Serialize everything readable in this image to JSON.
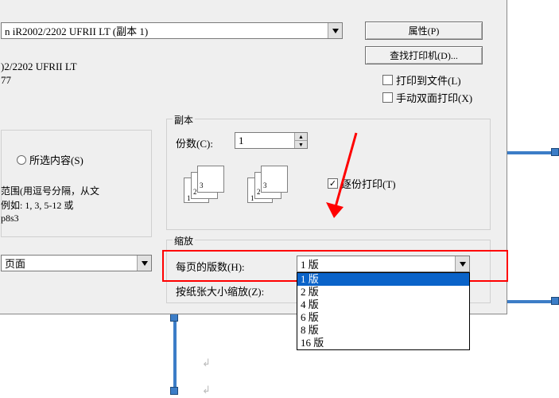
{
  "printer": {
    "selected": "n iR2002/2202 UFRII LT (副本 1)",
    "line2": ")2/2202 UFRII LT",
    "line3": "77"
  },
  "buttons": {
    "properties": "属性(P)",
    "findprinter": "查找打印机(D)..."
  },
  "checkboxes": {
    "printtofile": "打印到文件(L)",
    "manualduplex": "手动双面打印(X)",
    "collate": "逐份打印(T)"
  },
  "range": {
    "radio_selection": "所选内容(S)",
    "hint1": "范围(用逗号分隔，从文",
    "hint2": "例如: 1, 3, 5-12 或",
    "hint3": "p8s3"
  },
  "page_combo": "页面",
  "copies": {
    "legend": "副本",
    "label": "份数(C):",
    "value": "1",
    "small1": "1",
    "small2": "2",
    "small3": "3"
  },
  "scale": {
    "legend": "缩放",
    "pagesper_label": "每页的版数(H):",
    "pagesper_value": "1 版",
    "paperscale_label": "按纸张大小缩放(Z):",
    "options": [
      "1 版",
      "2 版",
      "4 版",
      "6 版",
      "8 版",
      "16 版"
    ]
  }
}
